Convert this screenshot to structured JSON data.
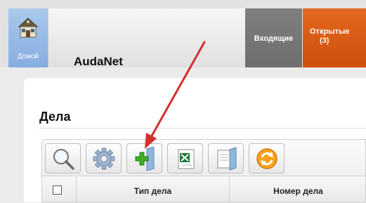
{
  "header": {
    "home_label": "Домой",
    "brand": "AudaNet",
    "tabs": [
      {
        "label": "Входящие"
      },
      {
        "label": "Открытые",
        "count": "(3)"
      }
    ]
  },
  "section": {
    "title": "Дела"
  },
  "toolbar": {
    "buttons": [
      {
        "icon": "search-icon"
      },
      {
        "icon": "gear-icon"
      },
      {
        "icon": "add-document-icon"
      },
      {
        "icon": "excel-icon"
      },
      {
        "icon": "documents-icon"
      },
      {
        "icon": "refresh-icon"
      }
    ]
  },
  "grid": {
    "columns": [
      "Тип дела",
      "Номер дела"
    ]
  },
  "colors": {
    "home_tile": "#86ade0",
    "incoming_tab": "#737373",
    "open_tab": "#d9590f",
    "annotation_arrow": "#d32f2f"
  }
}
